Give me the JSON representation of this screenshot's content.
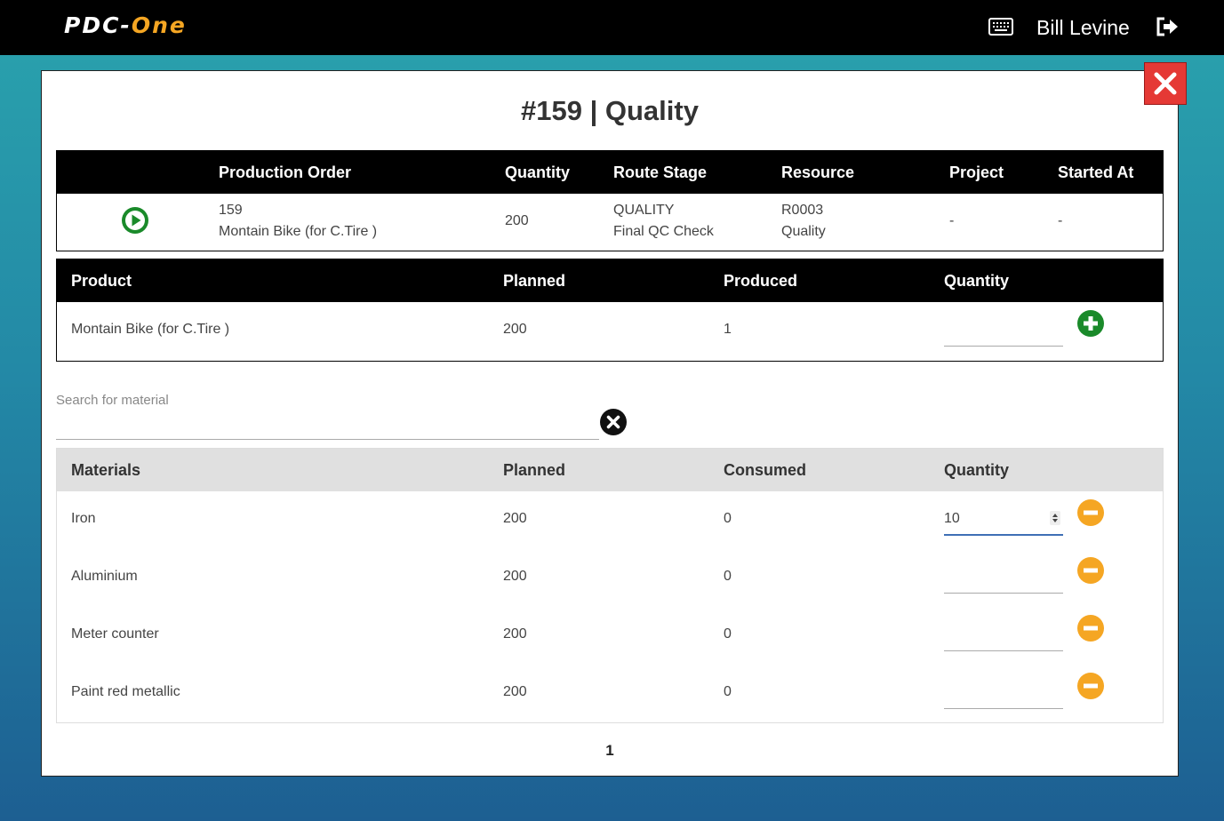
{
  "header": {
    "logo_part1": "PDC-",
    "logo_part2": "One",
    "user_name": "Bill Levine"
  },
  "modal": {
    "title": "#159 | Quality"
  },
  "production_order_table": {
    "headers": [
      "Production Order",
      "Quantity",
      "Route Stage",
      "Resource",
      "Project",
      "Started At"
    ],
    "row": {
      "order_number": "159",
      "order_product": "Montain Bike (for C.Tire )",
      "quantity": "200",
      "route_stage": "QUALITY",
      "route_stage_detail": "Final QC Check",
      "resource_code": "R0003",
      "resource_name": "Quality",
      "project": "-",
      "started_at": "-"
    }
  },
  "product_table": {
    "headers": [
      "Product",
      "Planned",
      "Produced",
      "Quantity"
    ],
    "row": {
      "product": "Montain Bike (for C.Tire )",
      "planned": "200",
      "produced": "1",
      "quantity": ""
    }
  },
  "search": {
    "label": "Search for material",
    "value": ""
  },
  "materials_table": {
    "headers": [
      "Materials",
      "Planned",
      "Consumed",
      "Quantity"
    ],
    "rows": [
      {
        "material": "Iron",
        "planned": "200",
        "consumed": "0",
        "quantity": "10"
      },
      {
        "material": "Aluminium",
        "planned": "200",
        "consumed": "0",
        "quantity": ""
      },
      {
        "material": "Meter counter",
        "planned": "200",
        "consumed": "0",
        "quantity": ""
      },
      {
        "material": "Paint red metallic",
        "planned": "200",
        "consumed": "0",
        "quantity": ""
      }
    ]
  },
  "pagination": {
    "current_page": "1"
  },
  "colors": {
    "accent_orange": "#f5a623",
    "play_green": "#1a8a2a",
    "close_red": "#e53935"
  },
  "icons": [
    "keyboard-icon",
    "logout-icon",
    "close-icon",
    "play-icon",
    "plus-circle-icon",
    "clear-search-icon",
    "minus-circle-icon"
  ]
}
